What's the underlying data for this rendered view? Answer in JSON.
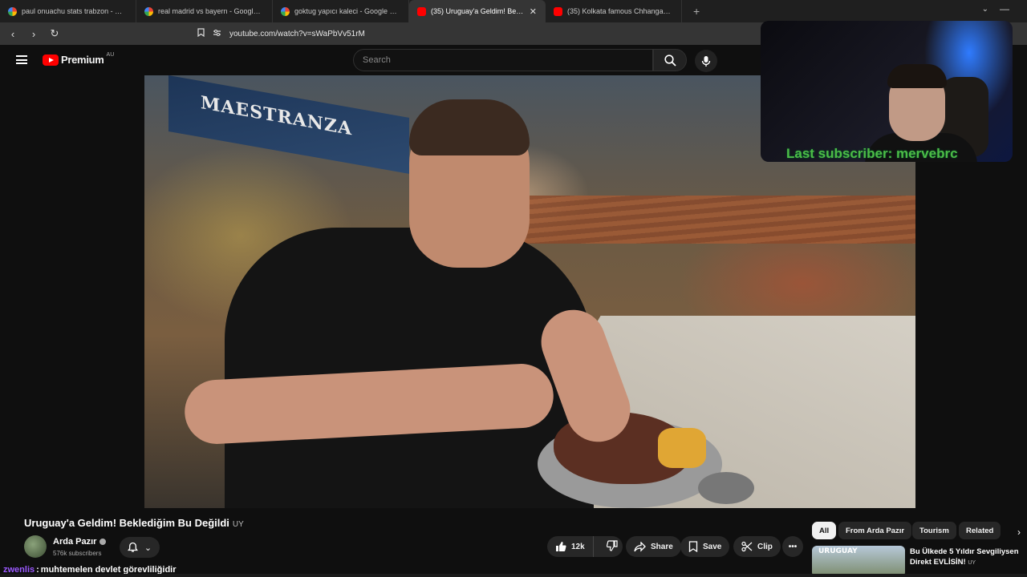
{
  "browser": {
    "tabs": [
      {
        "title": "paul onuachu stats trabzon - Google",
        "favicon": "google"
      },
      {
        "title": "real madrid vs bayern - Google Sear",
        "favicon": "google"
      },
      {
        "title": "goktug yapıcı kaleci - Google Search",
        "favicon": "google"
      },
      {
        "title": "(35) Uruguay'a Geldim! Beklediğ",
        "favicon": "youtube",
        "active": true
      },
      {
        "title": "(35) Kolkata famous Chhangani club",
        "favicon": "youtube"
      }
    ],
    "new_tab_icon": "+",
    "url": "youtube.com/watch?v=sWaPbVv51rM"
  },
  "youtube": {
    "logo_text": "Premium",
    "country_code": "AU",
    "search_placeholder": "Search"
  },
  "overlay": {
    "last_subscriber": "Last subscriber: mervebrc"
  },
  "video": {
    "sign_text": "MAESTRANZA",
    "title": "Uruguay'a Geldim! Beklediğim Bu Değildi",
    "title_flag": "UY",
    "channel": {
      "name": "Arda Pazır",
      "subscribers": "576k subscribers"
    },
    "actions": {
      "likes": "12k",
      "share": "Share",
      "save": "Save",
      "clip": "Clip"
    }
  },
  "chips": [
    "All",
    "From Arda Pazır",
    "Tourism",
    "Related"
  ],
  "related": {
    "thumb_text": "URUGUAY",
    "title": "Bu Ülkede 5 Yıldır Sevgiliysen Direkt EVLİSİN!",
    "title_flag": "UY"
  },
  "chat": {
    "user": "zwenlis",
    "separator": ":",
    "message": "muhtemelen devlet görevliliğidir"
  },
  "colors": {
    "youtube_red": "#ff0000",
    "subscriber_green": "#4dbb46",
    "chat_user": "#9b59ff"
  }
}
